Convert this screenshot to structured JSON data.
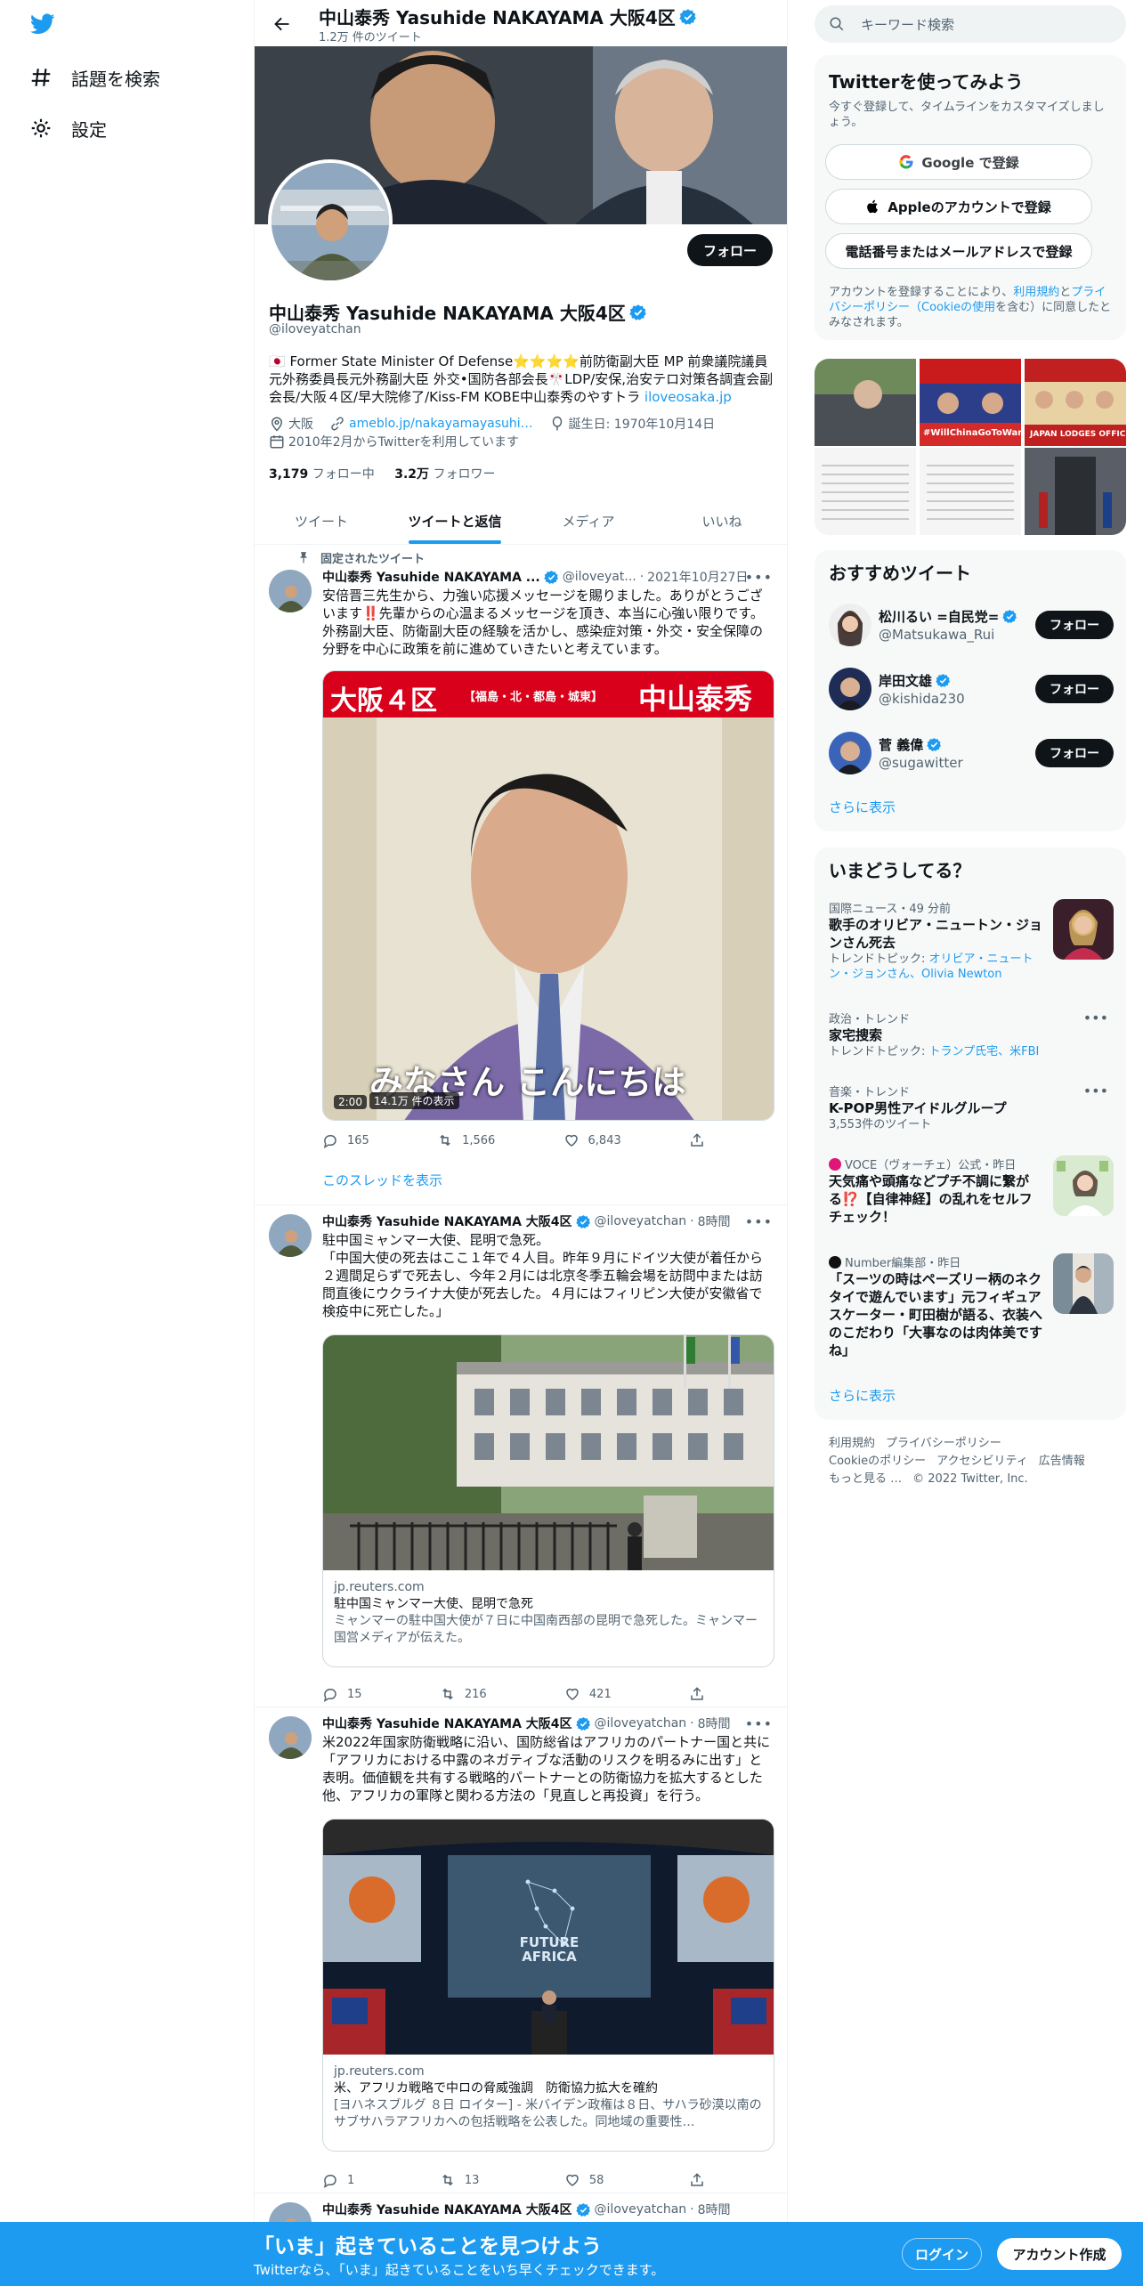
{
  "colors": {
    "accent": "#1d9bf0",
    "text": "#0f1419",
    "secondary": "#536471"
  },
  "nav": {
    "explore": "話題を検索",
    "settings": "設定"
  },
  "topbar": {
    "name": "中山泰秀 Yasuhide NAKAYAMA 大阪4区",
    "count": "1.2万 件のツイート"
  },
  "profile": {
    "follow": "フォロー",
    "name": "中山泰秀 Yasuhide NAKAYAMA 大阪4区",
    "handle": "@iloveyatchan",
    "bio": "🇯🇵 Former State Minister Of Defense⭐️⭐️⭐️⭐️前防衛副大臣 MP 前衆議院議員元外務委員長元外務副大臣 外交•国防各部会長🎌LDP/安保,治安テロ対策各調査会副会長/大阪４区/早大院修了/Kiss-FM KOBE中山泰秀のやすトラ ",
    "bio_link": "iloveosaka.jp",
    "location": "大阪",
    "website": "ameblo.jp/nakayamayasuhi…",
    "birthday": "誕生日: 1970年10月14日",
    "joined": "2010年2月からTwitterを利用しています",
    "following_count": "3,179",
    "following_label": " フォロー中",
    "followers_count": "3.2万",
    "followers_label": " フォロワー"
  },
  "tabs": [
    "ツイート",
    "ツイートと返信",
    "メディア",
    "いいね"
  ],
  "pinned_label": "固定されたツイート",
  "tweets": [
    {
      "name": "中山泰秀 Yasuhide NAKAYAMA ...",
      "handle": "@iloveyat...",
      "time": "2021年10月27日",
      "text": "安倍晋三先生から、力強い応援メッセージを賜りました。ありがとうございます‼️先輩からの心温まるメッセージを頂き、本当に心強い限りです。外務副大臣、防衛副大臣の経験を活かし、感染症対策・外交・安全保障の分野を中心に政策を前に進めていきたいと考えています。",
      "video_banner_left": "大阪４区",
      "video_banner_mid": "【福島・北・都島・城東】",
      "video_banner_right": "中山泰秀",
      "video_caption": "みなさん こんにちは",
      "video_duration": "2:00",
      "video_views": "14.1万 件の表示",
      "replies": "165",
      "retweets": "1,566",
      "likes": "6,843",
      "thread_link": "このスレッドを表示"
    },
    {
      "name": "中山泰秀 Yasuhide NAKAYAMA 大阪4区",
      "handle": "@iloveyatchan",
      "time": "8時間",
      "text": "駐中国ミャンマー大使、昆明で急死。\n「中国大使の死去はここ１年で４人目。昨年９月にドイツ大使が着任から２週間足らずで死去し、今年２月には北京冬季五輪会場を訪問中または訪問直後にウクライナ大使が死去した。４月にはフィリピン大使が安徽省で検疫中に死亡した。」",
      "card_domain": "jp.reuters.com",
      "card_title": "駐中国ミャンマー大使、昆明で急死",
      "card_desc": "ミャンマーの駐中国大使が７日に中国南西部の昆明で急死した。ミャンマー国営メディアが伝えた。",
      "replies": "15",
      "retweets": "216",
      "likes": "421"
    },
    {
      "name": "中山泰秀 Yasuhide NAKAYAMA 大阪4区",
      "handle": "@iloveyatchan",
      "time": "8時間",
      "text": "米2022年国家防衛戦略に沿い、国防総省はアフリカのパートナー国と共に「アフリカにおける中露のネガティブな活動のリスクを明るみに出す」と表明。価値観を共有する戦略的パートナーとの防衛協力を拡大するとした他、アフリカの軍隊と関わる方法の「見直しと再投資」を行う。",
      "screen_text": "FUTURE AFRICA",
      "card_domain": "jp.reuters.com",
      "card_title": "米、アフリカ戦略で中ロの脅威強調　防衛協力拡大を確約",
      "card_desc": "[ヨハネスブルグ ８日 ロイター] - 米バイデン政権は８日、サハラ砂漠以南のサブサハラアフリカへの包括戦略を公表した。同地域の重要性…",
      "replies": "1",
      "retweets": "13",
      "likes": "58"
    },
    {
      "name": "中山泰秀 Yasuhide NAKAYAMA 大阪4区",
      "handle": "@iloveyatchan",
      "time": "8時間"
    }
  ],
  "right": {
    "search_placeholder": "キーワード検索",
    "try_title": "Twitterを使ってみよう",
    "try_sub": "今すぐ登録して、タイムラインをカスタマイズしましょう。",
    "google_btn": "Google で登録",
    "apple_btn": "Appleのアカウントで登録",
    "phone_btn": "電話番号またはメールアドレスで登録",
    "terms_prefix": "アカウントを登録することにより、",
    "terms_link": "利用規約",
    "terms_mid": "と",
    "privacy_link": "プライバシーポリシー（Cookieの使用",
    "terms_suffix": "を含む）に同意したとみなされます。",
    "grid_tag1": "#WillChinaGoToWar",
    "grid_tag2": "JAPAN LODGES OFFICIAL",
    "rec_title": "おすすめツイート",
    "who": [
      {
        "name": "松川るい =自民党=",
        "handle": "@Matsukawa_Rui",
        "btn": "フォロー"
      },
      {
        "name": "岸田文雄",
        "handle": "@kishida230",
        "btn": "フォロー"
      },
      {
        "name": "菅 義偉",
        "handle": "@sugawitter",
        "btn": "フォロー"
      }
    ],
    "show_more": "さらに表示",
    "trends_title": "いまどうしてる？",
    "trends": [
      {
        "ctx": "国際ニュース・49 分前",
        "title": "歌手のオリビア・ニュートン・ジョンさん死去",
        "sub_prefix": "トレンドトピック: ",
        "sub_link": "オリビア・ニュートン・ジョンさん、Olivia Newton"
      },
      {
        "ctx": "政治・トレンド",
        "title": "家宅捜索",
        "sub_prefix": "トレンドトピック: ",
        "sub_link": "トランプ氏宅、米FBI"
      },
      {
        "ctx": "音楽・トレンド",
        "title": "K-POP男性アイドルグループ",
        "sub": "3,553件のツイート"
      },
      {
        "ctx": "VOCE（ヴォーチェ）公式・昨日",
        "title": "天気痛や頭痛などプチ不調に繋がる⁉️【自律神経】の乱れをセルフチェック！"
      },
      {
        "ctx": "Number編集部・昨日",
        "title": "「スーツの時はペーズリー柄のネクタイで遊んでいます」元フィギュアスケーター・町田樹が語る、衣装へのこだわり「大事なのは肉体美ですね」"
      }
    ],
    "show_more2": "さらに表示",
    "footer": [
      "利用規約",
      "プライバシーポリシー",
      "Cookieのポリシー",
      "アクセシビリティ",
      "広告情報",
      "もっと見る …",
      "© 2022 Twitter, Inc."
    ]
  },
  "bottom": {
    "title": "「いま」起きていることを見つけよう",
    "sub": "Twitterなら、「いま」起きていることをいち早くチェックできます。",
    "login": "ログイン",
    "signup": "アカウント作成"
  }
}
